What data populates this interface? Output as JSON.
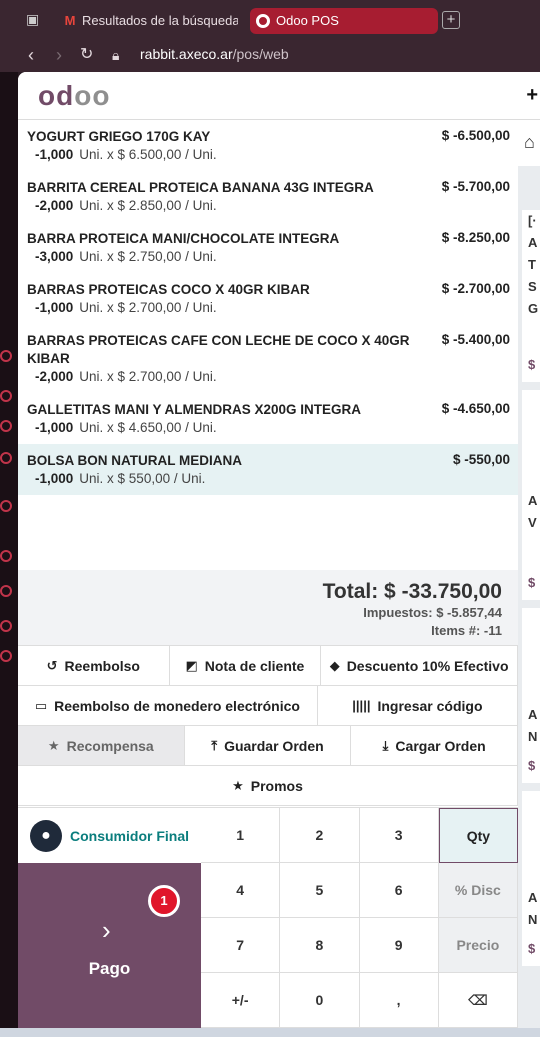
{
  "browser": {
    "tabs": [
      {
        "label": "Resultados de la búsqueda",
        "icon": "gmail-icon"
      },
      {
        "label": "Odoo POS",
        "icon": "odoo-icon"
      }
    ],
    "new_tab": "+",
    "url_host": "rabbit.axeco.ar",
    "url_path": "/pos/web"
  },
  "app": {
    "logo_main": "od",
    "logo_tail": "oo",
    "header_plus": "+"
  },
  "orderlines": [
    {
      "name": "YOGURT GRIEGO 170G KAY",
      "price": "$ -6.500,00",
      "qty": "-1,000",
      "unit_info": "Uni. x $ 6.500,00 / Uni."
    },
    {
      "name": "BARRITA CEREAL PROTEICA BANANA 43G INTEGRA",
      "price": "$ -5.700,00",
      "qty": "-2,000",
      "unit_info": "Uni. x $ 2.850,00 / Uni."
    },
    {
      "name": "BARRA PROTEICA MANI/CHOCOLATE INTEGRA",
      "price": "$ -8.250,00",
      "qty": "-3,000",
      "unit_info": "Uni. x $ 2.750,00 / Uni."
    },
    {
      "name": "BARRAS PROTEICAS COCO X 40GR KIBAR",
      "price": "$ -2.700,00",
      "qty": "-1,000",
      "unit_info": "Uni. x $ 2.700,00 / Uni."
    },
    {
      "name": "BARRAS PROTEICAS CAFE CON LECHE DE COCO X 40GR KIBAR",
      "price": "$ -5.400,00",
      "qty": "-2,000",
      "unit_info": "Uni. x $ 2.700,00 / Uni."
    },
    {
      "name": "GALLETITAS MANI Y ALMENDRAS X200G INTEGRA",
      "price": "$ -4.650,00",
      "qty": "-1,000",
      "unit_info": "Uni. x $ 4.650,00 / Uni."
    },
    {
      "name": "BOLSA BON NATURAL MEDIANA",
      "price": "$ -550,00",
      "qty": "-1,000",
      "unit_info": "Uni. x $ 550,00 / Uni."
    }
  ],
  "summary": {
    "total": "Total: $ -33.750,00",
    "taxes": "Impuestos: $ -5.857,44",
    "items": "Items #: -11"
  },
  "controls": {
    "refund": "Reembolso",
    "customer_note": "Nota de cliente",
    "discount": "Descuento 10% Efectivo",
    "ewallet_refund": "Reembolso de monedero electrónico",
    "enter_code": "Ingresar código",
    "reward": "Recompensa",
    "save_order": "Guardar Orden",
    "load_order": "Cargar Orden",
    "promos": "Promos"
  },
  "customer": {
    "name": "Consumidor Final"
  },
  "payment": {
    "label": "Pago",
    "badge": "1"
  },
  "numpad": {
    "k1": "1",
    "k2": "2",
    "k3": "3",
    "qty": "Qty",
    "k4": "4",
    "k5": "5",
    "k6": "6",
    "disc": "% Disc",
    "k7": "7",
    "k8": "8",
    "k9": "9",
    "price": "Precio",
    "sign": "+/-",
    "k0": "0",
    "comma": ",",
    "backspace": "⌫"
  },
  "product_cards": [
    {
      "text": "[·\nA\nT\nS\nG",
      "price": "$"
    },
    {
      "text": "A\nV",
      "price": "$"
    },
    {
      "text": "A\nN",
      "price": "$"
    },
    {
      "text": "A\nN",
      "price": "$"
    }
  ]
}
